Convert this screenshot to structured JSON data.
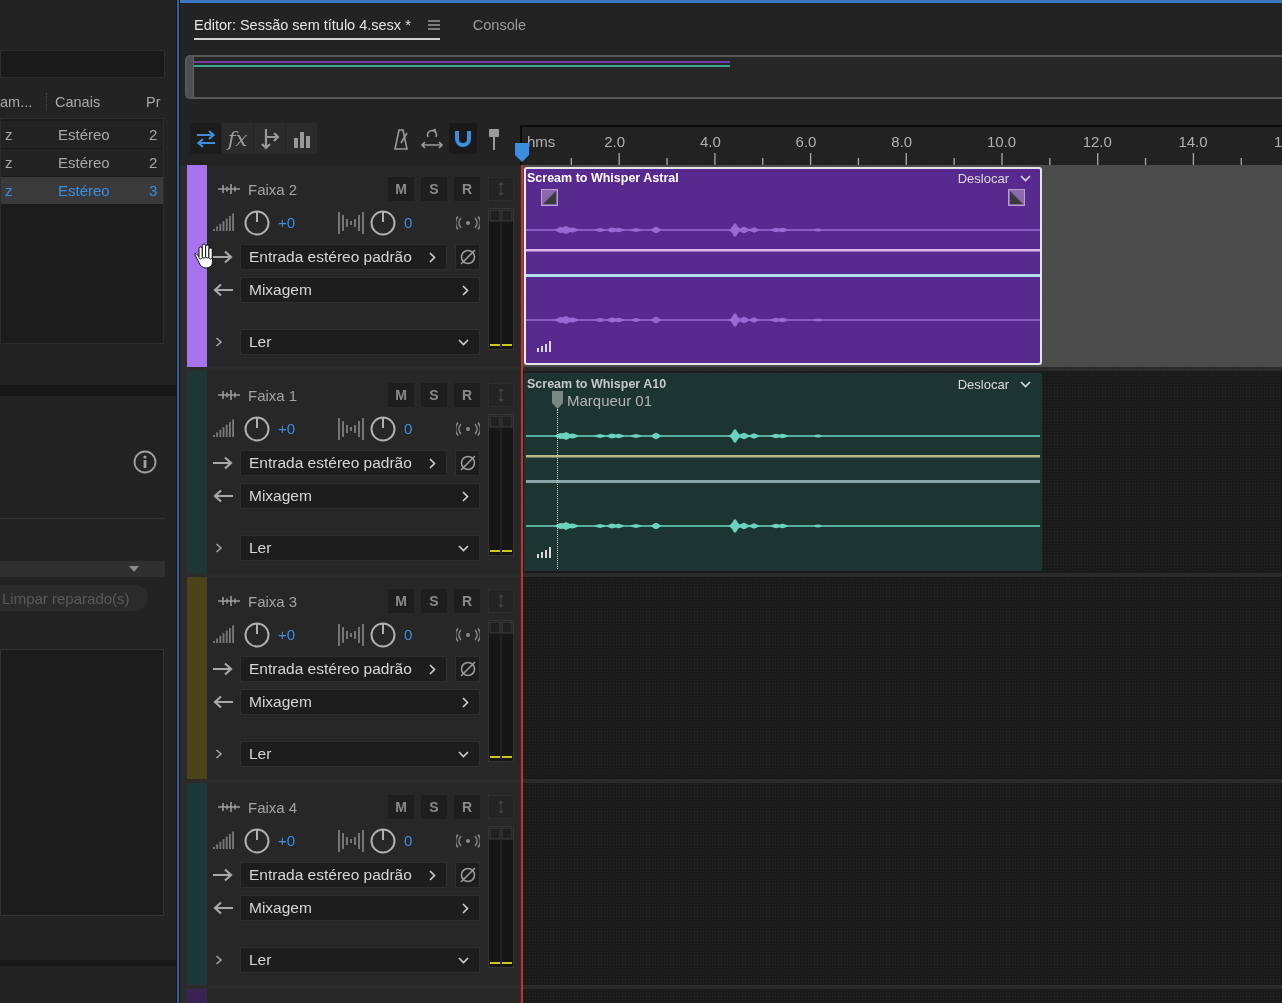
{
  "files_panel": {
    "columns": [
      "am...",
      "Canais",
      "Pr"
    ],
    "rows": [
      {
        "cells": [
          "z",
          "Estéreo",
          "2"
        ],
        "selected": false
      },
      {
        "cells": [
          "z",
          "Estéreo",
          "2"
        ],
        "selected": false
      },
      {
        "cells": [
          "z",
          "Estéreo",
          "3"
        ],
        "selected": true
      }
    ]
  },
  "repair_panel": {
    "clear_button": {
      "label": "Limpar reparado(s)",
      "disabled": true
    }
  },
  "editor_tabs": [
    {
      "label": "Editor: Sessão sem título 4.sesx *",
      "selected": true,
      "has_menu": true
    },
    {
      "label": "Console",
      "selected": false,
      "has_menu": false
    }
  ],
  "toolbar": {
    "view_tools": [
      {
        "kind": "swap",
        "selected": true
      },
      {
        "kind": "fx",
        "label": "fx",
        "selected": false
      },
      {
        "kind": "route",
        "selected": false
      },
      {
        "kind": "meter",
        "selected": false
      }
    ],
    "edit_tools": [
      {
        "kind": "metronome",
        "selected": false
      },
      {
        "kind": "loop",
        "selected": false
      },
      {
        "kind": "snap",
        "selected": true
      },
      {
        "kind": "marker",
        "selected": false
      }
    ]
  },
  "ruler": {
    "unit": "hms",
    "labels": [
      "2.0",
      "4.0",
      "6.0",
      "8.0",
      "10.0",
      "12.0",
      "14.0",
      "1"
    ]
  },
  "tracks": [
    {
      "name": "Faixa 2",
      "color": "#a673ec",
      "selected": true,
      "buttons": [
        "M",
        "S",
        "R"
      ],
      "volume": "+0",
      "pan": "0",
      "input": "Entrada estéreo padrão",
      "output": "Mixagem",
      "mode": "Ler",
      "clip": {
        "title": "Scream to Whisper Astral",
        "mode": "Deslocar",
        "color": "#58298f",
        "selected": true
      }
    },
    {
      "name": "Faixa 1",
      "color": "#1d3833",
      "selected": false,
      "buttons": [
        "M",
        "S",
        "R"
      ],
      "volume": "+0",
      "pan": "0",
      "input": "Entrada estéreo padrão",
      "output": "Mixagem",
      "mode": "Ler",
      "clip": {
        "title": "Scream to Whisper A10",
        "mode": "Deslocar",
        "color": "#1c3530",
        "selected": false,
        "marker": "Marqueur 01"
      }
    },
    {
      "name": "Faixa 3",
      "color": "#4b4418",
      "selected": false,
      "buttons": [
        "M",
        "S",
        "R"
      ],
      "volume": "+0",
      "pan": "0",
      "input": "Entrada estéreo padrão",
      "output": "Mixagem",
      "mode": "Ler"
    },
    {
      "name": "Faixa 4",
      "color": "#1c3838",
      "selected": false,
      "buttons": [
        "M",
        "S",
        "R"
      ],
      "volume": "+0",
      "pan": "0",
      "input": "Entrada estéreo padrão",
      "output": "Mixagem",
      "mode": "Ler"
    },
    {
      "color": "#3a2350",
      "selected": false
    }
  ]
}
